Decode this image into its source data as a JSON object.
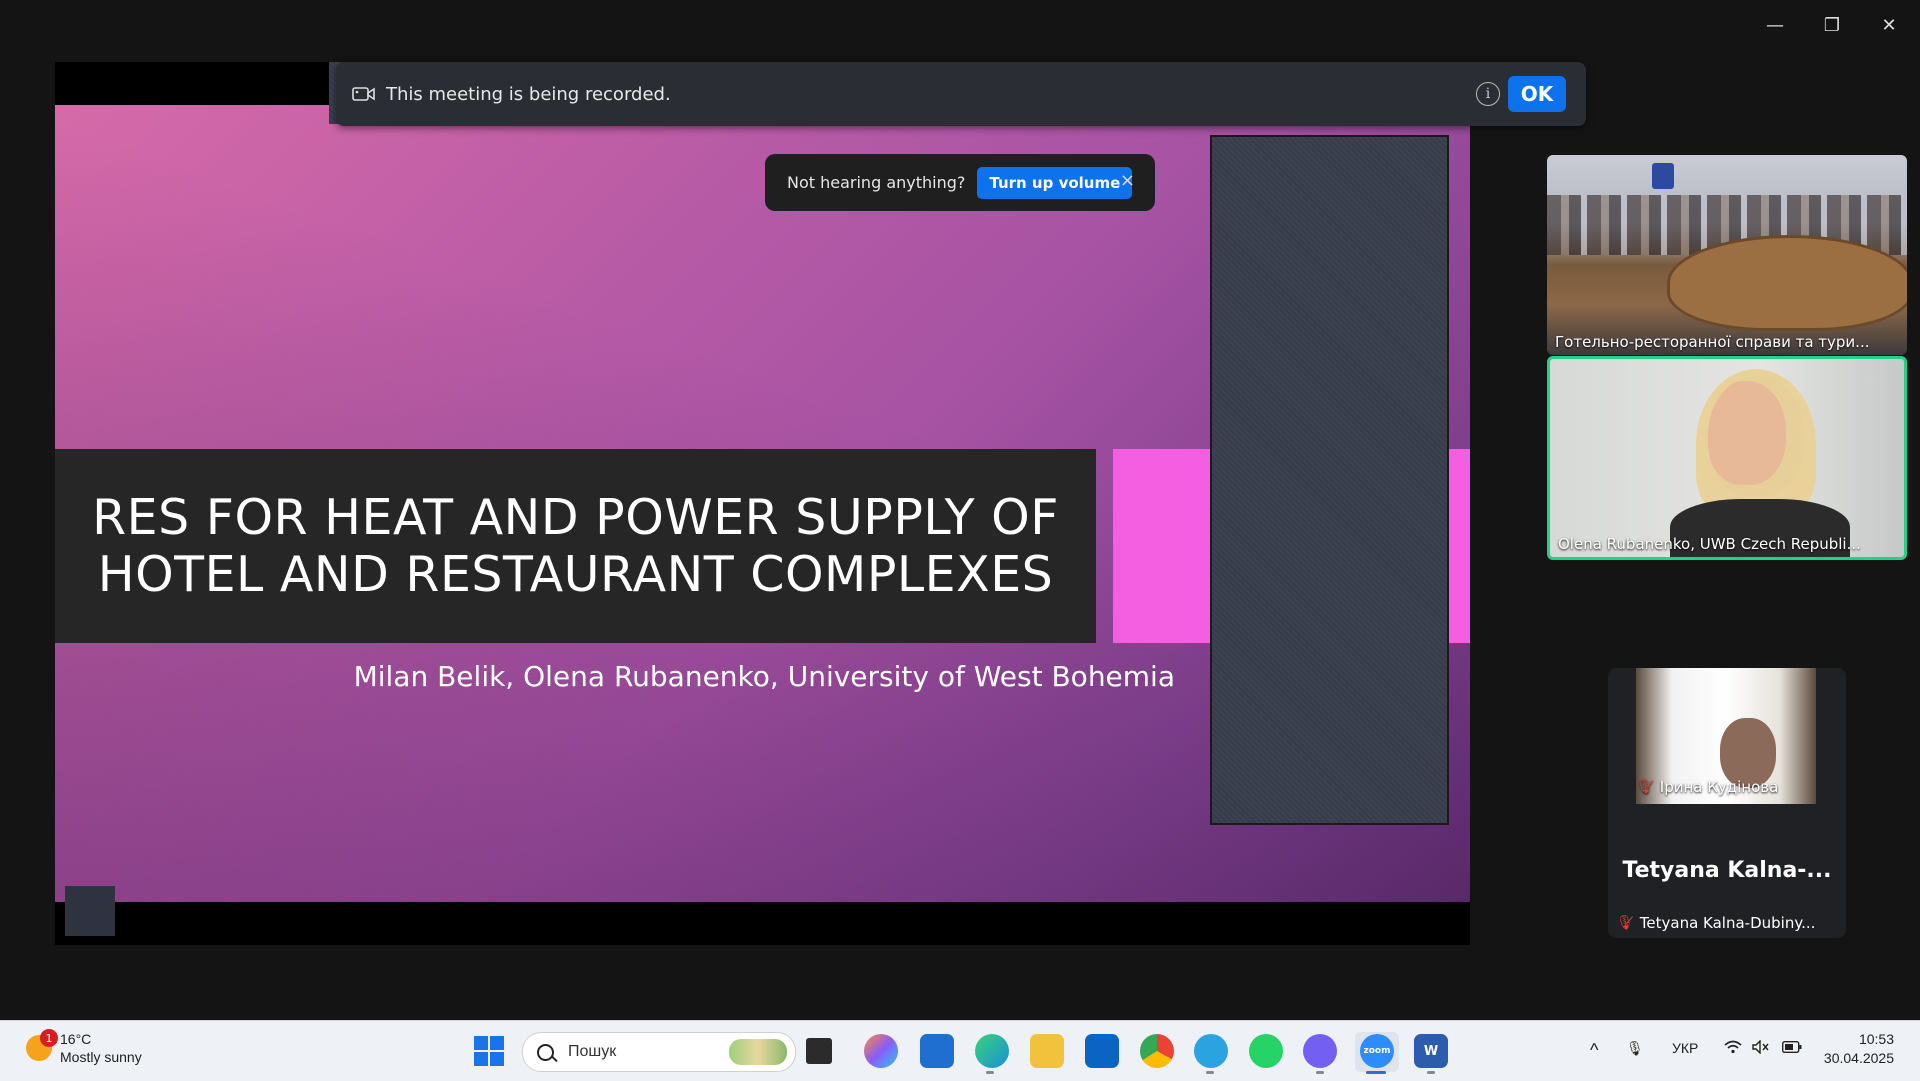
{
  "window": {
    "minimize": "—",
    "restore": "❐",
    "close": "✕"
  },
  "recording_banner": {
    "text": "This meeting is being recorded.",
    "info": "i",
    "ok_label": "OK"
  },
  "volume_toast": {
    "text": "Not hearing anything?",
    "button_label": "Turn up volume",
    "close": "×"
  },
  "slide": {
    "title_line1": "RES FOR HEAT AND POWER SUPPLY OF",
    "title_line2": "HOTEL AND RESTAURANT COMPLEXES",
    "authors": "Milan Belik, Olena Rubanenko, University of West Bohemia"
  },
  "participants": [
    {
      "label": "Готельно-ресторанної справи та тури..."
    },
    {
      "label": "Olena Rubanenko, UWB Czech Republi..."
    },
    {
      "label": "Ірина  Кудінова"
    },
    {
      "name": "Tetyana  Kalna-...",
      "label": "Tetyana Kalna-Dubiny..."
    }
  ],
  "taskbar": {
    "weather": {
      "temp": "16°C",
      "desc": "Mostly sunny",
      "badge": "1"
    },
    "search_placeholder": "Пошук",
    "apps": [
      {
        "name": "task-view",
        "color": "#333333"
      },
      {
        "name": "copilot",
        "color": "#8a5cf5"
      },
      {
        "name": "microsoft-store",
        "color": "#1f6fd1"
      },
      {
        "name": "edge",
        "color": "#1aa3c9"
      },
      {
        "name": "file-explorer",
        "color": "#f2c23c"
      },
      {
        "name": "outlook",
        "color": "#0a64c4"
      },
      {
        "name": "chrome",
        "color": "#34a853"
      },
      {
        "name": "telegram",
        "color": "#2aa3e0"
      },
      {
        "name": "whatsapp",
        "color": "#25d366"
      },
      {
        "name": "viber",
        "color": "#7360f2"
      },
      {
        "name": "zoom",
        "color": "#2d8cff",
        "text": "zoom"
      },
      {
        "name": "word",
        "color": "#2b5cad",
        "text": "W"
      }
    ],
    "tray": {
      "chevron": "^",
      "language": "УКР"
    },
    "clock": {
      "time": "10:53",
      "date": "30.04.2025"
    }
  }
}
